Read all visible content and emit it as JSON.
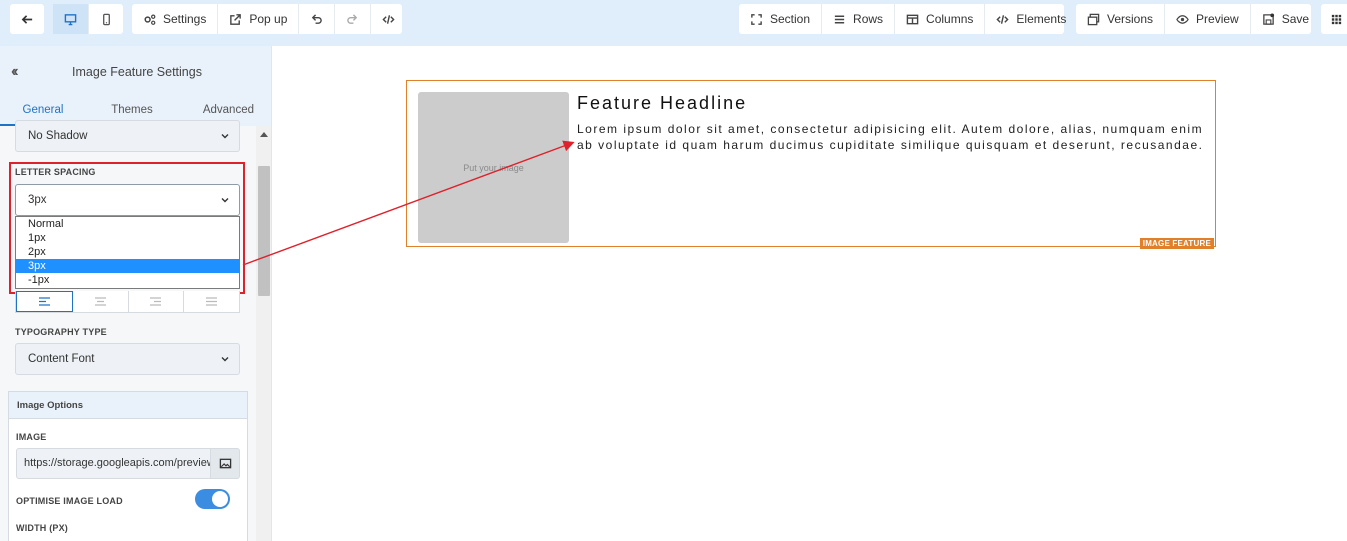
{
  "toolbar": {
    "back_icon": "arrow-left-icon",
    "desktop_icon": "monitor-icon",
    "mobile_icon": "phone-icon",
    "settings_label": "Settings",
    "popup_label": "Pop up",
    "undo_icon": "undo-icon",
    "redo_icon": "redo-icon",
    "code_icon": "code-icon",
    "section_label": "Section",
    "rows_label": "Rows",
    "columns_label": "Columns",
    "elements_label": "Elements",
    "versions_label": "Versions",
    "preview_label": "Preview",
    "save_label": "Save",
    "apps_icon": "grid-icon"
  },
  "panel": {
    "title": "Image Feature Settings",
    "tabs": [
      {
        "label": "General",
        "active": true
      },
      {
        "label": "Themes",
        "active": false
      },
      {
        "label": "Advanced",
        "active": false
      }
    ],
    "shadow_select": {
      "value": "No Shadow"
    },
    "letter_spacing": {
      "label": "LETTER SPACING",
      "value": "3px",
      "options": [
        "Normal",
        "1px",
        "2px",
        "3px",
        "-1px"
      ],
      "selected_index": 3
    },
    "typography": {
      "label": "TYPOGRAPHY TYPE",
      "value": "Content Font"
    },
    "image_options": {
      "title": "Image Options",
      "image_label": "IMAGE",
      "image_url": "https://storage.googleapis.com/preview",
      "optimise_label": "OPTIMISE IMAGE LOAD",
      "optimise_on": true,
      "width_label": "WIDTH (PX)"
    }
  },
  "canvas": {
    "image_placeholder": "Put your image",
    "headline": "Feature Headline",
    "body": "Lorem ipsum dolor sit amet, consectetur adipisicing elit. Autem dolore, alias, numquam enim ab voluptate id quam harum ducimus cupiditate similique quisquam et deserunt, recusandae.",
    "tag": "IMAGE FEATURE"
  },
  "colors": {
    "accent": "#1f73c7",
    "highlight": "#e0202a",
    "feature_border": "#e0802a"
  }
}
